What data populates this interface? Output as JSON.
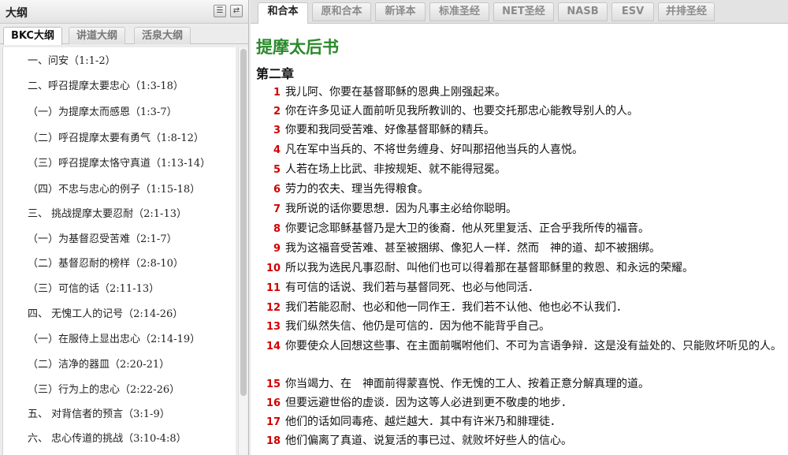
{
  "left_panel": {
    "title": "大纲",
    "tabs": [
      "BKC大纲",
      "讲道大纲",
      "活泉大纲"
    ],
    "outline": [
      "一、问安（1:1-2）",
      "二、呼召提摩太要忠心（1:3-18）",
      "（一）为提摩太而感恩（1:3-7）",
      "（二）呼召提摩太要有勇气（1:8-12）",
      "（三）呼召提摩太恪守真道（1:13-14）",
      "（四）不忠与忠心的例子（1:15-18）",
      "三、 挑战提摩太要忍耐（2:1-13）",
      "（一）为基督忍受苦难（2:1-7）",
      "（二）基督忍耐的榜样（2:8-10）",
      "（三）可信的话（2:11-13）",
      "四、 无愧工人的记号（2:14-26）",
      "（一）在服侍上显出忠心（2:14-19）",
      "（二）洁净的器皿（2:20-21）",
      "（三）行为上的忠心（2:22-26）",
      "五、 对背信者的预言（3:1-9）",
      "六、 忠心传道的挑战（3:10-4:8）"
    ]
  },
  "right_panel": {
    "tabs": [
      "和合本",
      "原和合本",
      "新译本",
      "标准圣经",
      "NET圣经",
      "NASB",
      "ESV",
      "并排圣经"
    ],
    "book_title": "提摩太后书",
    "chapter": "第二章",
    "verses": [
      {
        "n": "1",
        "text": "我儿阿、你要在基督耶稣的恩典上刚强起来。"
      },
      {
        "n": "2",
        "text": "你在许多见证人面前听见我所教训的、也要交托那忠心能教导别人的人。"
      },
      {
        "n": "3",
        "text": "你要和我同受苦难、好像基督耶稣的精兵。"
      },
      {
        "n": "4",
        "text": "凡在军中当兵的、不将世务缠身、好叫那招他当兵的人喜悦。"
      },
      {
        "n": "5",
        "text": "人若在场上比武、非按规矩、就不能得冠冕。"
      },
      {
        "n": "6",
        "text": "劳力的农夫、理当先得粮食。"
      },
      {
        "n": "7",
        "text": "我所说的话你要思想．因为凡事主必给你聪明。"
      },
      {
        "n": "8",
        "text": "你要记念耶稣基督乃是大卫的後裔．他从死里复活、正合乎我所传的福音。"
      },
      {
        "n": "9",
        "text": "我为这福音受苦难、甚至被捆绑、像犯人一样．然而　神的道、却不被捆绑。"
      },
      {
        "n": "10",
        "text": "所以我为选民凡事忍耐、叫他们也可以得着那在基督耶稣里的救恩、和永远的荣耀。"
      },
      {
        "n": "11",
        "text": "有可信的话说、我们若与基督同死、也必与他同活．"
      },
      {
        "n": "12",
        "text": "我们若能忍耐、也必和他一同作王．我们若不认他、他也必不认我们．"
      },
      {
        "n": "13",
        "text": "我们纵然失信、他仍是可信的．因为他不能背乎自己。"
      },
      {
        "n": "14",
        "text": "你要使众人回想这些事、在主面前嘱咐他们、不可为言语争辩．这是没有益处的、只能败坏听见的人。"
      },
      {
        "n": "15",
        "text": "你当竭力、在　神面前得蒙喜悦、作无愧的工人、按着正意分解真理的道。"
      },
      {
        "n": "16",
        "text": "但要远避世俗的虚谈．因为这等人必进到更不敬虔的地步．"
      },
      {
        "n": "17",
        "text": "他们的话如同毒疮、越烂越大．其中有许米乃和腓理徒．"
      },
      {
        "n": "18",
        "text": "他们偏离了真道、说复活的事已过、就败坏好些人的信心。"
      }
    ]
  },
  "colors": {
    "title_green": "#2a8a2a",
    "verse_number_red": "#d00000"
  },
  "icons": [
    "list-icon",
    "refresh-icon"
  ]
}
